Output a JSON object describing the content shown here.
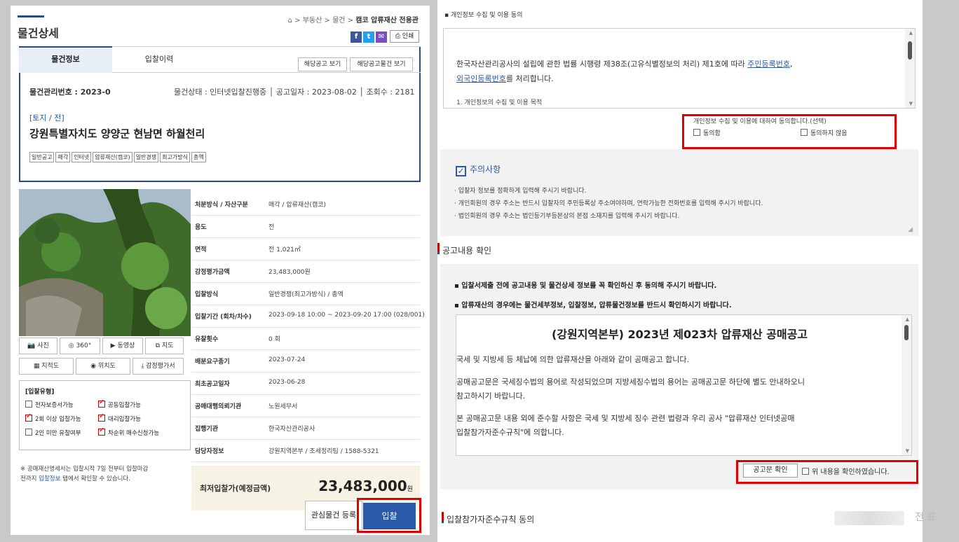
{
  "left": {
    "page_title": "물건상세",
    "breadcrumb": {
      "home": "⌂",
      "sep": ">",
      "b1": "부동산",
      "b2": "물건",
      "b3": "캠코 압류재산 전용관"
    },
    "share": {
      "fb": "f",
      "tw": "t",
      "mail": "✉",
      "print": "⎙ 인쇄"
    },
    "tabs": [
      "물건정보",
      "입찰이력"
    ],
    "buttons": {
      "notice": "해당공고 보기",
      "notice_items": "해당공고물건 보기"
    },
    "manage_no_label": "물건관리번호 : 2023-0",
    "status": "물건상태 : 인터넷입찰진행중",
    "notice_date": "공고일자 : 2023-08-02",
    "views": "조회수 : 2181",
    "category": "[토지 / 전]",
    "address": "강원특별자치도 양양군 현남면 하월천리",
    "badges": [
      "일반공고",
      "매각",
      "인터넷",
      "압류재산(캠코)",
      "일반경쟁",
      "최고가방식",
      "총액"
    ],
    "media_buttons": [
      {
        "icon": "📷",
        "label": "사진"
      },
      {
        "icon": "◎",
        "label": "360°"
      },
      {
        "icon": "▶",
        "label": "동영상"
      },
      {
        "icon": "⧉",
        "label": "지도"
      },
      {
        "icon": "▦",
        "label": "지적도"
      },
      {
        "icon": "◉",
        "label": "위치도"
      },
      {
        "icon": "⤓",
        "label": "감정평가서"
      }
    ],
    "bid_type_title": "[입찰유형]",
    "bid_types": [
      {
        "label": "전자보증서가능",
        "checked": false
      },
      {
        "label": "공동입찰가능",
        "checked": true
      },
      {
        "label": "2회 이상 입찰가능",
        "checked": true
      },
      {
        "label": "대리입찰가능",
        "checked": true
      },
      {
        "label": "2인 미만 유찰여부",
        "checked": false
      },
      {
        "label": "차순위 매수신청가능",
        "checked": true
      }
    ],
    "note_1": "※ 공매재산명세서는 입찰시작 7일 전부터 입찰마감",
    "note_2a": "전까지 ",
    "note_link": "입찰정보",
    "note_2b": " 탭에서 확인할 수 있습니다.",
    "details": [
      {
        "k": "처분방식 / 자산구분",
        "v": "매각 / 압류재산(캠코)"
      },
      {
        "k": "용도",
        "v": "전"
      },
      {
        "k": "면적",
        "v": "전 1,021㎡"
      },
      {
        "k": "감정평가금액",
        "v": "23,483,000원"
      },
      {
        "k": "입찰방식",
        "v": "일반경쟁(최고가방식) / 총액"
      },
      {
        "k": "입찰기간 (회차/차수)",
        "v": "2023-09-18 10:00 ~ 2023-09-20 17:00 (028/001)"
      },
      {
        "k": "유찰횟수",
        "v": "0 회"
      },
      {
        "k": "배분요구종기",
        "v": "2023-07-24"
      },
      {
        "k": "최초공고일자",
        "v": "2023-06-28"
      },
      {
        "k": "공매대행의뢰기관",
        "v": "노원세무서"
      },
      {
        "k": "집행기관",
        "v": "한국자산관리공사"
      },
      {
        "k": "담당자정보",
        "v": "강원지역본부 / 조세정리팀 / 1588-5321"
      }
    ],
    "min_price_label": "최저입찰가(예정금액)",
    "min_price": "23,483,000",
    "min_price_unit": "원",
    "wish_button": "관심물건 등록",
    "bid_button": "입찰"
  },
  "right": {
    "privacy_title": "▪ 개인정보 수집 및 이용 동의",
    "privacy_text_1a": "한국자산관리공사의 설립에 관한 법률 시행령 제38조(고유식별정보의 처리) 제1호에 따라 ",
    "privacy_link_1": "주민등록번호",
    "privacy_text_1b": ",",
    "privacy_link_2": "외국인등록번호",
    "privacy_text_1c": "를 처리합니다.",
    "privacy_text_2": "1. 개인정보의 수집 및 이용 목적",
    "consent_question": "개인정보 수집 및 이용에 대하여 동의합니다.(선택)",
    "consent_yes": "동의함",
    "consent_no": "동의하지 않음",
    "caution_title": "주의사항",
    "caution_items": [
      "· 입찰자 정보를 정확하게 입력해 주시기 바랍니다.",
      "· 개인회원의 경우 주소는 반드시 입찰자의 주민등록상 주소여야하며, 연락가능한 전화번호를 입력해 주시기 바랍니다.",
      "· 법인회원의 경우 주소는 법인등기부등본상의 본점 소재지를 입력해 주시기 바랍니다."
    ],
    "notice_section": "공고내용 확인",
    "notice_bullets": [
      "▪ 입찰서제출 전에 공고내용 및 물건상세 정보를 꼭 확인하신 후 동의해 주시기 바랍니다.",
      "▪ 압류재산의 경우에는 물건세부정보, 입찰정보, 압류물건정보를 반드시 확인하시기 바랍니다."
    ],
    "notice_heading": "(강원지역본부) 2023년 제023차 압류재산 공매공고",
    "notice_p1": "국세 및 지방세 등 체납에 의한 압류재산을 아래와 같이 공매공고 합니다.",
    "notice_p2a": "공매공고문은 국세징수법의 용어로 작성되었으며 지방세징수법의 용어는 공매공고문 하단에 별도 안내하오니",
    "notice_p2b": "참고하시기 바랍니다.",
    "notice_p3a": "본 공매공고문 내용 외에 준수할 사항은 국세 및 지방세 징수 관련 법령과 우리 공사 \"압류재산 인터넷공매",
    "notice_p3b": "입찰참가자준수규칙\"에 의합니다.",
    "notice_confirm_btn": "공고문 확인",
    "notice_checked_label": "위 내용을 확인하였습니다.",
    "rules_section": "입찰참가자준수규칙 동의",
    "corner_text": "전 표"
  },
  "colors": {
    "accent": "#2a4a8c",
    "link": "#2a5aa8",
    "highlight": "#e00000"
  }
}
